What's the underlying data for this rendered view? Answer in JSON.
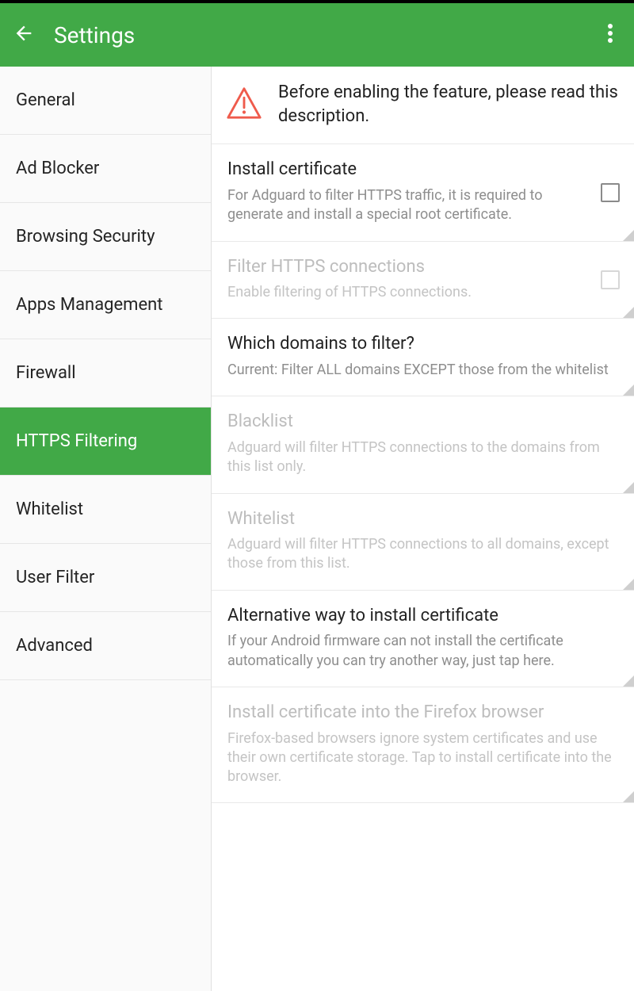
{
  "appbar": {
    "title": "Settings"
  },
  "sidebar": {
    "items": [
      {
        "label": "General"
      },
      {
        "label": "Ad Blocker"
      },
      {
        "label": "Browsing Security"
      },
      {
        "label": "Apps Management"
      },
      {
        "label": "Firewall"
      },
      {
        "label": "HTTPS Filtering"
      },
      {
        "label": "Whitelist"
      },
      {
        "label": "User Filter"
      },
      {
        "label": "Advanced"
      }
    ],
    "active_index": 5
  },
  "warning": {
    "text": "Before enabling the feature, please read this description."
  },
  "rows": {
    "install_cert": {
      "title": "Install certificate",
      "sub": "For Adguard to filter HTTPS traffic, it is required to generate and install a special root certificate."
    },
    "filter_https": {
      "title": "Filter HTTPS connections",
      "sub": "Enable filtering of HTTPS connections."
    },
    "which_domains": {
      "title": "Which domains to filter?",
      "sub": "Current: Filter ALL domains EXCEPT those from the whitelist"
    },
    "blacklist": {
      "title": "Blacklist",
      "sub": "Adguard will filter HTTPS connections to the domains from this list only."
    },
    "whitelist": {
      "title": "Whitelist",
      "sub": "Adguard will filter HTTPS connections to all domains, except those from this list."
    },
    "alt_install": {
      "title": "Alternative way to install certificate",
      "sub": "If your Android firmware can not install the certificate automatically you can try another way, just tap here."
    },
    "firefox": {
      "title": "Install certificate into the Firefox browser",
      "sub": "Firefox-based browsers ignore system certificates and use their own certificate storage. Tap to install certificate into the browser."
    }
  }
}
